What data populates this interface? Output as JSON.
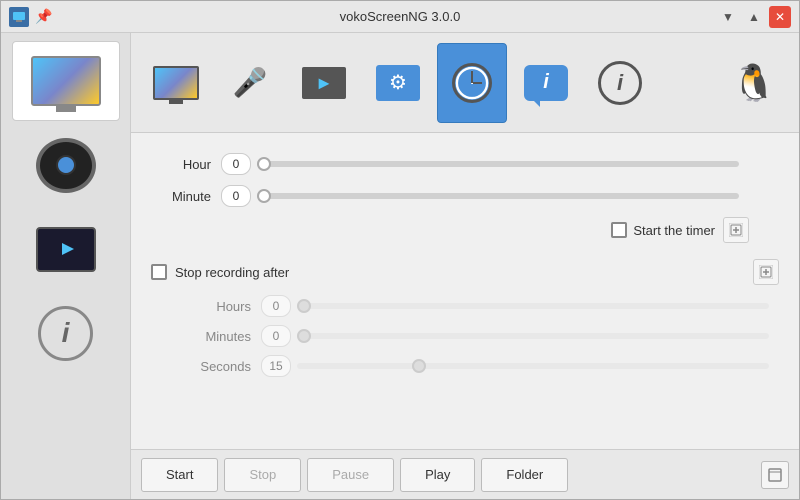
{
  "titlebar": {
    "title": "vokoScreenNG 3.0.0",
    "pin_label": "📌",
    "minimize_label": "▼",
    "maximize_label": "▲",
    "close_label": "✕"
  },
  "toolbar": {
    "buttons": [
      {
        "id": "screen",
        "label": ""
      },
      {
        "id": "audio",
        "label": ""
      },
      {
        "id": "video",
        "label": ""
      },
      {
        "id": "settings",
        "label": ""
      },
      {
        "id": "timer",
        "label": ""
      },
      {
        "id": "chat",
        "label": ""
      },
      {
        "id": "info",
        "label": ""
      }
    ]
  },
  "timer": {
    "hour_label": "Hour",
    "hour_value": "0",
    "minute_label": "Minute",
    "minute_value": "0",
    "start_timer_label": "Start the timer",
    "stop_recording_label": "Stop recording after",
    "hours_label": "Hours",
    "hours_value": "0",
    "minutes_label": "Minutes",
    "minutes_value": "0",
    "seconds_label": "Seconds",
    "seconds_value": "15"
  },
  "bottom_toolbar": {
    "start_label": "Start",
    "stop_label": "Stop",
    "pause_label": "Pause",
    "play_label": "Play",
    "folder_label": "Folder"
  },
  "sidebar": {
    "items": [
      {
        "id": "screen",
        "label": "Screen"
      },
      {
        "id": "webcam",
        "label": "Webcam"
      },
      {
        "id": "player",
        "label": "Player"
      },
      {
        "id": "info",
        "label": "Info"
      }
    ]
  }
}
